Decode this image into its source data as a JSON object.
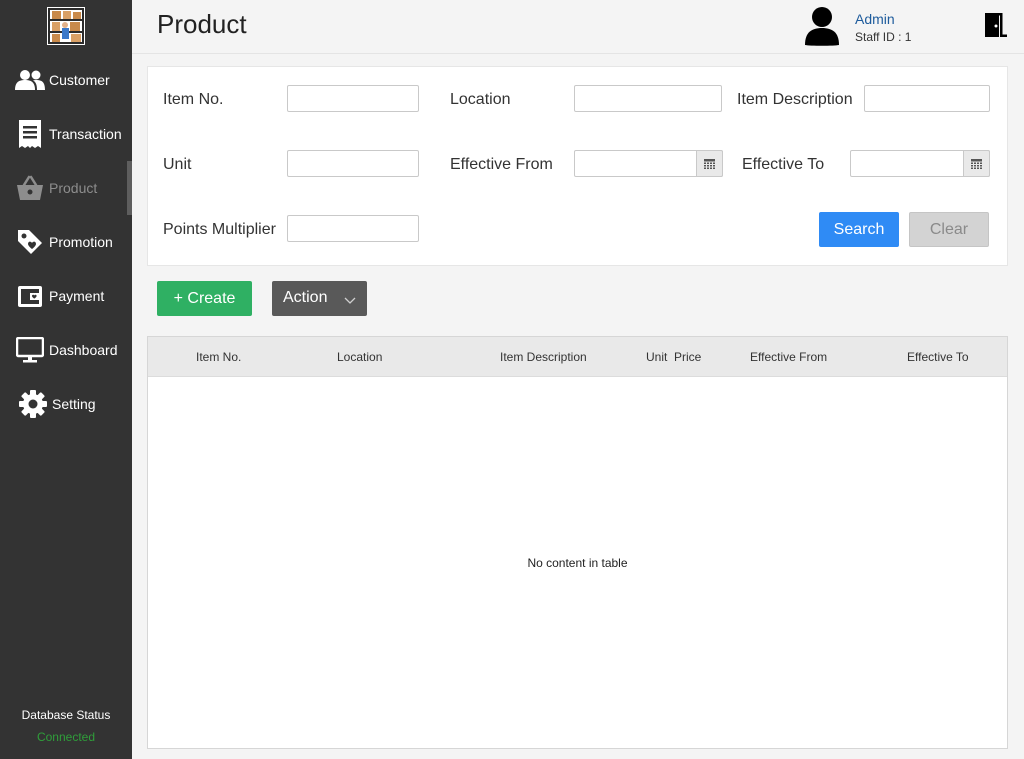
{
  "sidebar": {
    "logo_icon": "warehouse-boxes-icon",
    "items": [
      {
        "label": "Customer",
        "icon": "users-icon"
      },
      {
        "label": "Transaction",
        "icon": "receipt-icon"
      },
      {
        "label": "Product",
        "icon": "basket-icon",
        "active": true
      },
      {
        "label": "Promotion",
        "icon": "tag-icon"
      },
      {
        "label": "Payment",
        "icon": "wallet-icon"
      },
      {
        "label": "Dashboard",
        "icon": "monitor-icon"
      },
      {
        "label": "Setting",
        "icon": "gear-icon"
      }
    ],
    "db_status_label": "Database Status",
    "db_status_value": "Connected",
    "db_status_color": "#2f9e3a"
  },
  "header": {
    "title": "Product",
    "user_name": "Admin",
    "staff_id": "Staff ID :  1",
    "avatar_icon": "user-avatar-icon",
    "logout_icon": "exit-door-icon"
  },
  "filters": {
    "item_no": {
      "label": "Item No.",
      "value": ""
    },
    "location": {
      "label": "Location",
      "value": ""
    },
    "item_description": {
      "label": "Item Description",
      "value": ""
    },
    "unit": {
      "label": "Unit",
      "value": ""
    },
    "effective_from": {
      "label": "Effective From",
      "value": ""
    },
    "effective_to": {
      "label": "Effective To",
      "value": ""
    },
    "points_multiplier": {
      "label": "Points Multiplier",
      "value": ""
    },
    "search_label": "Search",
    "clear_label": "Clear"
  },
  "actions": {
    "create_label": "+ Create",
    "action_label": "Action"
  },
  "table": {
    "columns": [
      "Item No.",
      "Location",
      "Item Description",
      "Unit  Price",
      "Effective From",
      "Effective To"
    ],
    "rows": [],
    "empty_text": "No content in table"
  },
  "colors": {
    "sidebar_bg": "#333333",
    "primary": "#2f8bf5",
    "create_green": "#2fb063",
    "action_gray": "#595959"
  }
}
